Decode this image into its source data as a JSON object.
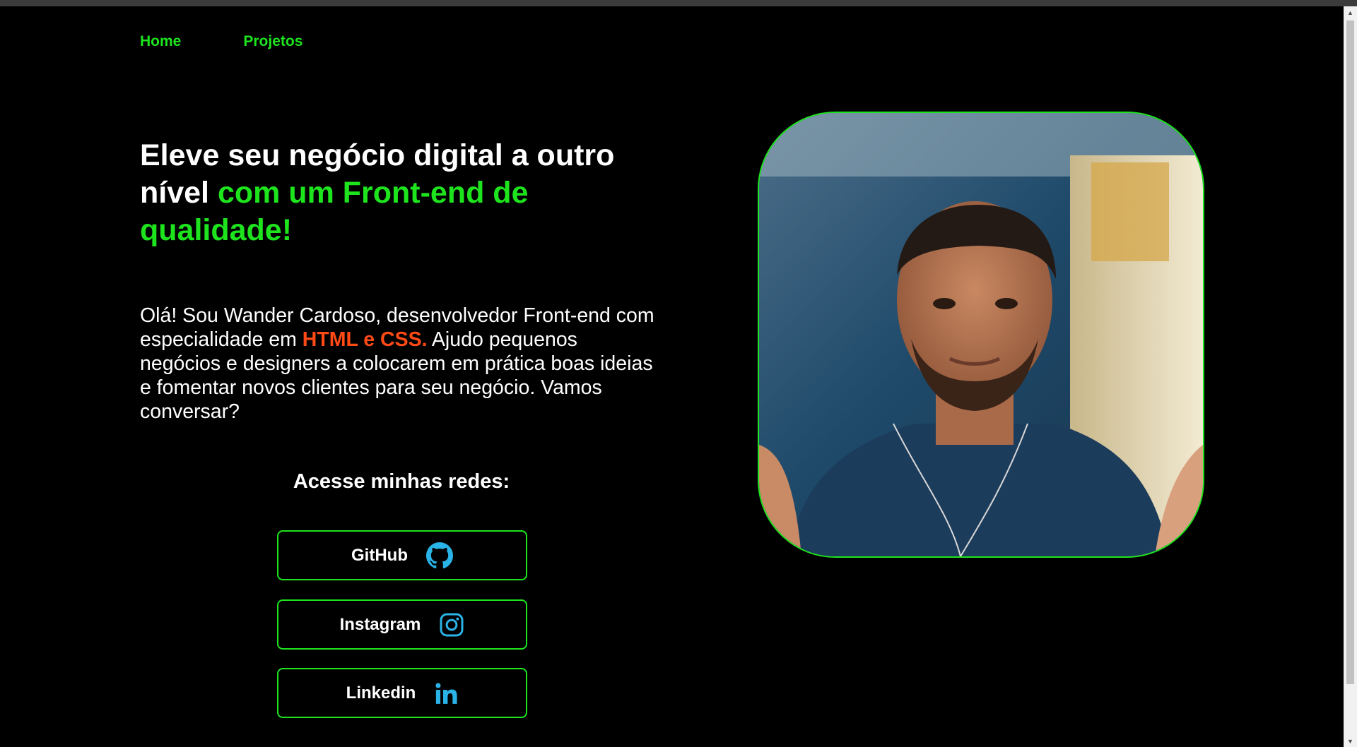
{
  "nav": {
    "items": [
      {
        "label": "Home"
      },
      {
        "label": "Projetos"
      }
    ]
  },
  "hero": {
    "headline_plain": "Eleve seu negócio digital a outro nível ",
    "headline_accent": "com um Front-end de qualidade!",
    "intro_before": "Olá! Sou Wander Cardoso, desenvolvedor Front-end com especialidade em ",
    "intro_highlight": "HTML e CSS.",
    "intro_after": " Ajudo pequenos negócios e designers a colocarem em prática boas ideias e fomentar novos clientes para seu negócio. Vamos conversar?"
  },
  "social": {
    "title": "Acesse minhas redes:",
    "buttons": [
      {
        "label": "GitHub",
        "icon": "github-icon"
      },
      {
        "label": "Instagram",
        "icon": "instagram-icon"
      },
      {
        "label": "Linkedin",
        "icon": "linkedin-icon"
      }
    ]
  },
  "profile": {
    "image": "profile-photo"
  },
  "colors": {
    "accent": "#1ee41e",
    "highlight": "#ff4a16",
    "background": "#000000",
    "icon": "#2ab3e6"
  }
}
